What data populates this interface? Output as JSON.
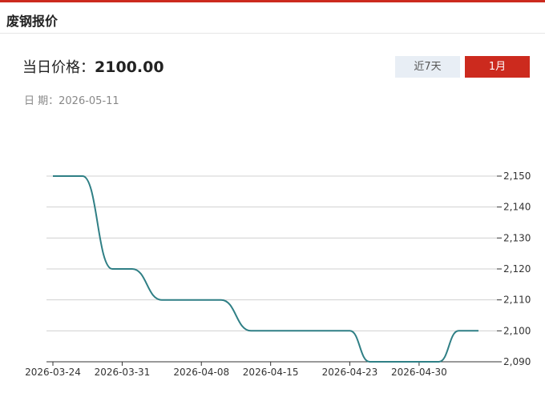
{
  "header": {
    "title": "废钢报价"
  },
  "price": {
    "label": "当日价格：",
    "value": "2100.00"
  },
  "date": {
    "label": "日 期：",
    "value": "2026-05-11"
  },
  "tabs": [
    {
      "label": "近7天",
      "active": false
    },
    {
      "label": "1月",
      "active": true
    }
  ],
  "colors": {
    "accent": "#cc2a1e",
    "line": "#2f7f85",
    "tab_inactive_bg": "#e8eef5"
  },
  "chart_data": {
    "type": "line",
    "x": [
      "2026-03-24",
      "2026-03-31",
      "2026-04-08",
      "2026-04-15",
      "2026-04-23",
      "2026-04-30"
    ],
    "x_ticks": [
      "2026-03-24",
      "2026-03-31",
      "2026-04-08",
      "2026-04-15",
      "2026-04-23",
      "2026-04-30"
    ],
    "y_ticks": [
      2090,
      2100,
      2110,
      2120,
      2130,
      2140,
      2150
    ],
    "y_tick_labels": [
      "2,090",
      "2,100",
      "2,110",
      "2,120",
      "2,130",
      "2,140",
      "2,150"
    ],
    "ylim": [
      2090,
      2150
    ],
    "grid": true,
    "series": [
      {
        "points": [
          [
            "2026-03-24",
            2150
          ],
          [
            "2026-03-27",
            2150
          ],
          [
            "2026-03-30",
            2120
          ],
          [
            "2026-04-01",
            2120
          ],
          [
            "2026-04-04",
            2110
          ],
          [
            "2026-04-10",
            2110
          ],
          [
            "2026-04-13",
            2100
          ],
          [
            "2026-04-23",
            2100
          ],
          [
            "2026-04-25",
            2090
          ],
          [
            "2026-05-02",
            2090
          ],
          [
            "2026-05-04",
            2100
          ],
          [
            "2026-05-06",
            2100
          ]
        ]
      }
    ]
  }
}
